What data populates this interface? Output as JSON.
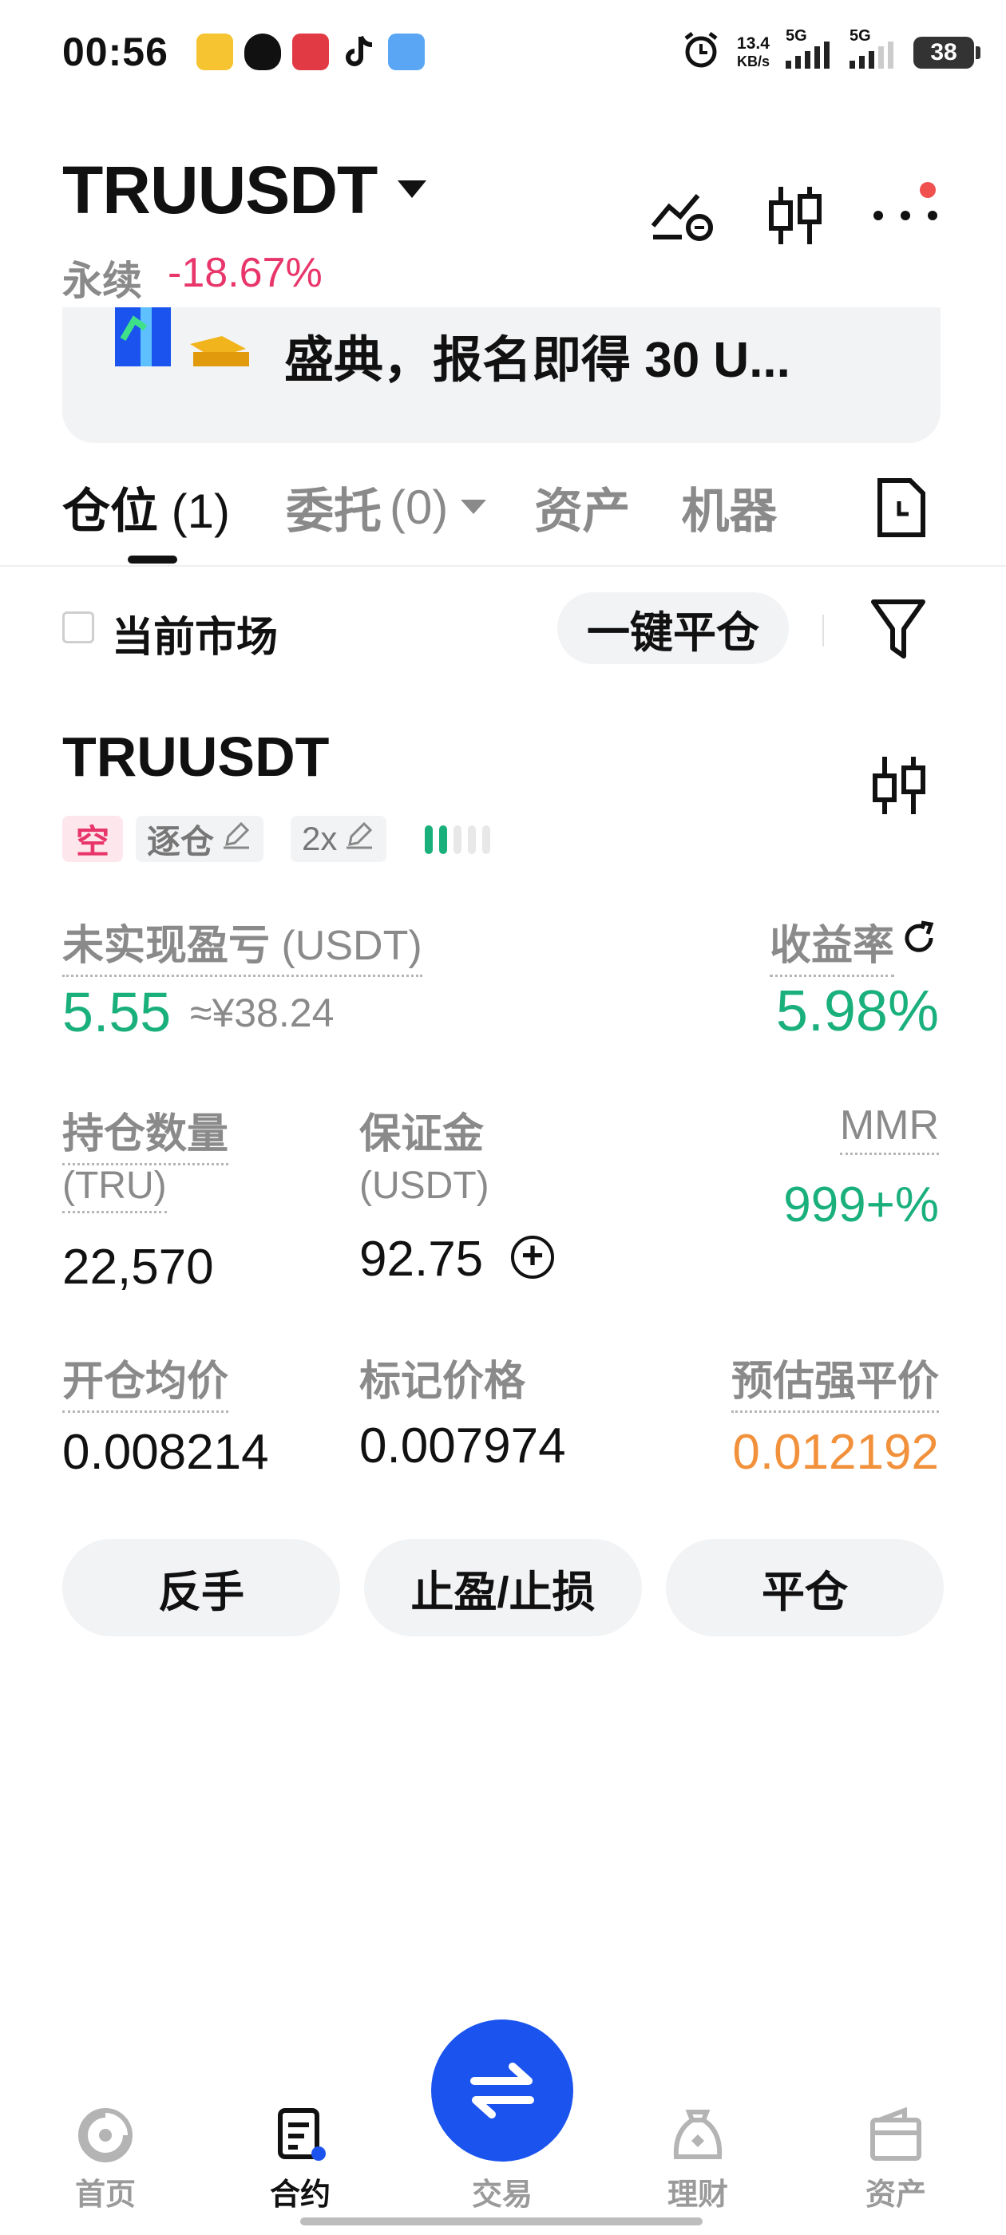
{
  "status_bar": {
    "time": "00:56",
    "net_speed": "13.4",
    "net_unit": "KB/s",
    "signal1": "5G",
    "signal2": "5G",
    "battery": "38"
  },
  "header": {
    "pair": "TRUUSDT",
    "contract_type": "永续",
    "change": "-18.67%"
  },
  "banner": {
    "text": "盛典，报名即得 30 U..."
  },
  "tabs": [
    {
      "label": "仓位",
      "count": "(1)"
    },
    {
      "label": "委托",
      "count": "(0)"
    },
    {
      "label": "资产",
      "count": ""
    },
    {
      "label": "机器",
      "count": ""
    }
  ],
  "filter": {
    "current_market_label": "当前市场",
    "close_all_label": "一键平仓"
  },
  "position": {
    "symbol": "TRUUSDT",
    "side_badge": "空",
    "margin_mode": "逐仓",
    "leverage": "2x",
    "risk_level_filled": 2,
    "risk_level_total": 5,
    "upnl_label": "未实现盈亏",
    "upnl_unit": "(USDT)",
    "upnl_value": "5.55",
    "upnl_cny": "≈¥38.24",
    "roe_label": "收益率",
    "roe_value": "5.98%",
    "qty_label": "持仓数量",
    "qty_unit": "(TRU)",
    "qty_value": "22,570",
    "margin_label": "保证金",
    "margin_unit": "(USDT)",
    "margin_value": "92.75",
    "mmr_label": "MMR",
    "mmr_value": "999+%",
    "entry_label": "开仓均价",
    "entry_value": "0.008214",
    "mark_label": "标记价格",
    "mark_value": "0.007974",
    "liq_label": "预估强平价",
    "liq_value": "0.012192"
  },
  "actions": {
    "reverse": "反手",
    "tpsl": "止盈/止损",
    "close": "平仓"
  },
  "bottom_nav": {
    "home": "首页",
    "futures": "合约",
    "trade": "交易",
    "earn": "理财",
    "assets": "资产"
  },
  "colors": {
    "positive": "#1ab07c",
    "negative": "#e8356a",
    "liquidation": "#f2913c",
    "accent": "#1a53ee"
  }
}
